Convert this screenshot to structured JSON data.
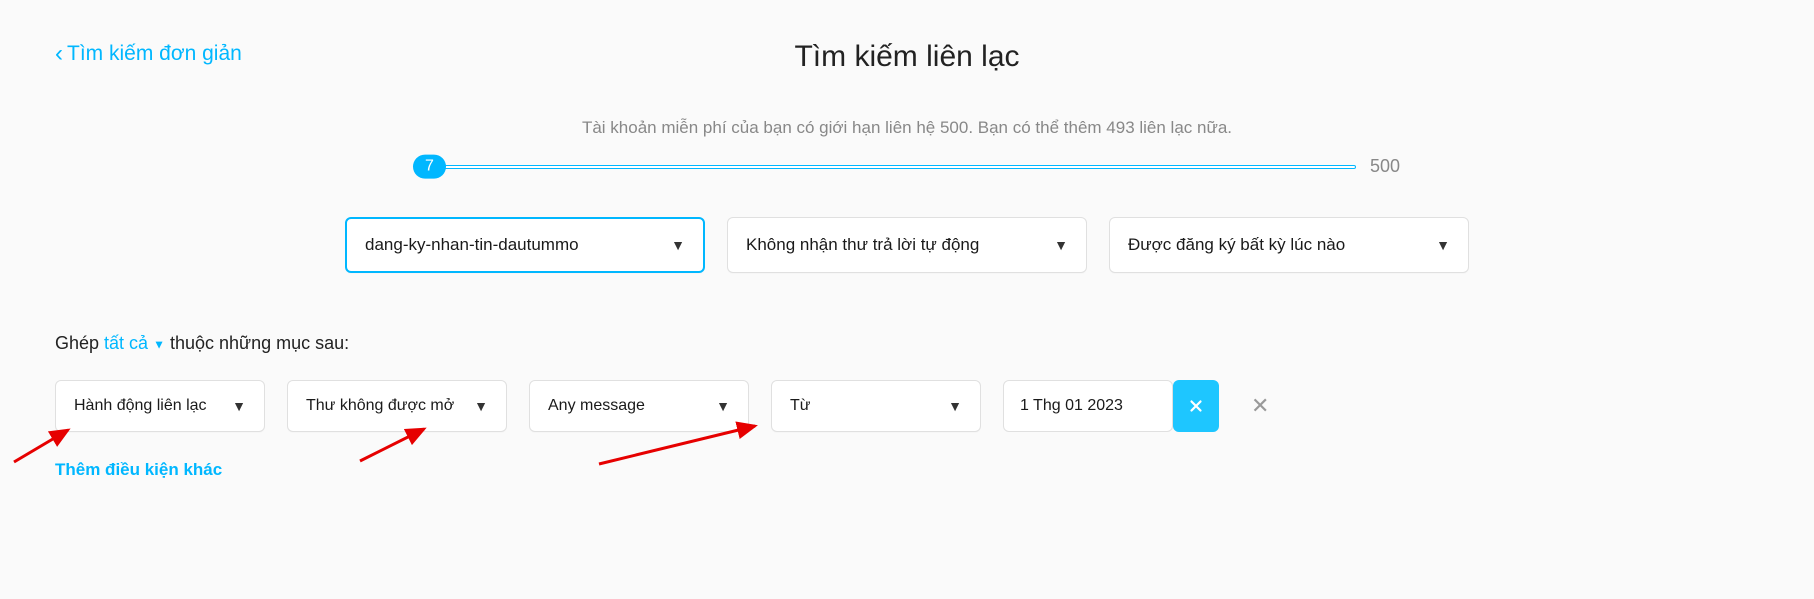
{
  "header": {
    "simple_search_label": "Tìm kiếm đơn giản",
    "page_title": "Tìm kiếm liên lạc"
  },
  "limit": {
    "text": "Tài khoản miễn phí của bạn có giới hạn liên hệ 500. Bạn có thể thêm 493 liên lạc nữa.",
    "current": "7",
    "max": "500"
  },
  "top_filters": {
    "reg_form": "dang-ky-nhan-tin-dautummo",
    "autoresponder": "Không nhận thư trả lời tự động",
    "subscription_time": "Được đăng ký bất kỳ lúc nào"
  },
  "match": {
    "prefix": "Ghép ",
    "link": "tất cả",
    "suffix": " thuộc những mục sau:"
  },
  "filters": {
    "field": "Hành động liên lạc",
    "condition": "Thư không được mở",
    "message": "Any message",
    "direction": "Từ",
    "date": "1 Thg 01 2023"
  },
  "actions": {
    "add_condition": "Thêm điều kiện khác"
  }
}
